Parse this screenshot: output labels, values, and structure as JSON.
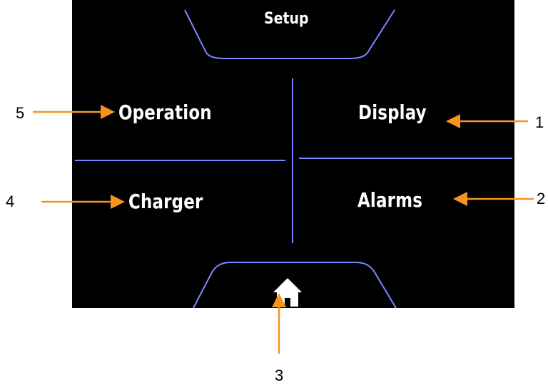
{
  "screen": {
    "title": "Setup",
    "menu": {
      "operation": "Operation",
      "display": "Display",
      "charger": "Charger",
      "alarms": "Alarms"
    },
    "home_icon": "home-icon"
  },
  "callouts": {
    "one": "1",
    "two": "2",
    "three": "3",
    "four": "4",
    "five": "5"
  },
  "colors": {
    "screen_background": "#000000",
    "frame_lines": "#7d86ff",
    "label_text": "#ffffff",
    "callout_arrow": "#f7941d"
  }
}
